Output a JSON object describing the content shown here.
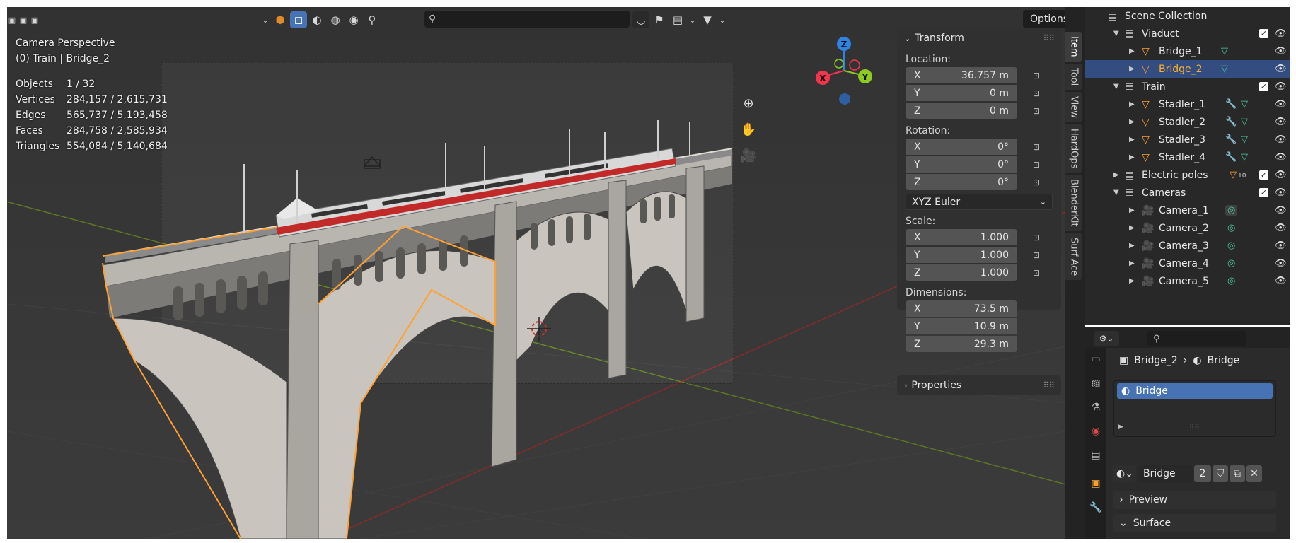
{
  "viewport": {
    "header": {
      "search_placeholder": "",
      "options_label": "Options"
    },
    "overlay": {
      "perspective": "Camera Perspective",
      "selection": "(0) Train | Bridge_2"
    },
    "stats": [
      {
        "label": "Objects",
        "value": "1 / 32"
      },
      {
        "label": "Vertices",
        "value": "284,157 / 2,615,731"
      },
      {
        "label": "Edges",
        "value": "565,737 / 5,193,458"
      },
      {
        "label": "Faces",
        "value": "284,758 / 2,585,934"
      },
      {
        "label": "Triangles",
        "value": "554,084 / 5,140,684"
      }
    ],
    "gizmo": {
      "x": "X",
      "y": "Y",
      "z": "Z"
    }
  },
  "npanel": {
    "transform_title": "Transform",
    "location_label": "Location:",
    "location": [
      {
        "axis": "X",
        "value": "36.757 m"
      },
      {
        "axis": "Y",
        "value": "0 m"
      },
      {
        "axis": "Z",
        "value": "0 m"
      }
    ],
    "rotation_label": "Rotation:",
    "rotation": [
      {
        "axis": "X",
        "value": "0°"
      },
      {
        "axis": "Y",
        "value": "0°"
      },
      {
        "axis": "Z",
        "value": "0°"
      }
    ],
    "rotation_mode": "XYZ Euler",
    "scale_label": "Scale:",
    "scale": [
      {
        "axis": "X",
        "value": "1.000"
      },
      {
        "axis": "Y",
        "value": "1.000"
      },
      {
        "axis": "Z",
        "value": "1.000"
      }
    ],
    "dimensions_label": "Dimensions:",
    "dimensions": [
      {
        "axis": "X",
        "value": "73.5 m"
      },
      {
        "axis": "Y",
        "value": "10.9 m"
      },
      {
        "axis": "Z",
        "value": "29.3 m"
      }
    ],
    "properties_title": "Properties"
  },
  "vtabs": [
    "Item",
    "Tool",
    "View",
    "HardOps",
    "BlenderKit",
    "Surf Ace"
  ],
  "outliner": {
    "root": "Scene Collection",
    "rows": [
      {
        "name": "Viaduct",
        "kind": "collection"
      },
      {
        "name": "Bridge_1",
        "kind": "mesh"
      },
      {
        "name": "Bridge_2",
        "kind": "mesh"
      },
      {
        "name": "Train",
        "kind": "collection"
      },
      {
        "name": "Stadler_1",
        "kind": "mesh"
      },
      {
        "name": "Stadler_2",
        "kind": "mesh"
      },
      {
        "name": "Stadler_3",
        "kind": "mesh"
      },
      {
        "name": "Stadler_4",
        "kind": "mesh"
      },
      {
        "name": "Electric poles",
        "kind": "collection",
        "count": "10"
      },
      {
        "name": "Cameras",
        "kind": "collection"
      },
      {
        "name": "Camera_1",
        "kind": "camera"
      },
      {
        "name": "Camera_2",
        "kind": "camera"
      },
      {
        "name": "Camera_3",
        "kind": "camera"
      },
      {
        "name": "Camera_4",
        "kind": "camera"
      },
      {
        "name": "Camera_5",
        "kind": "camera"
      }
    ]
  },
  "properties": {
    "search_placeholder": "",
    "breadcrumb_object": "Bridge_2",
    "breadcrumb_material": "Bridge",
    "material_slot": "Bridge",
    "material_name": "Bridge",
    "user_count": "2",
    "preview_label": "Preview",
    "surface_label": "Surface"
  },
  "colors": {
    "accent": "#4772b3",
    "selection_orange": "#ffa033",
    "axis_x": "#f5344e",
    "axis_y": "#8bcb23",
    "axis_z": "#2f83e3"
  }
}
